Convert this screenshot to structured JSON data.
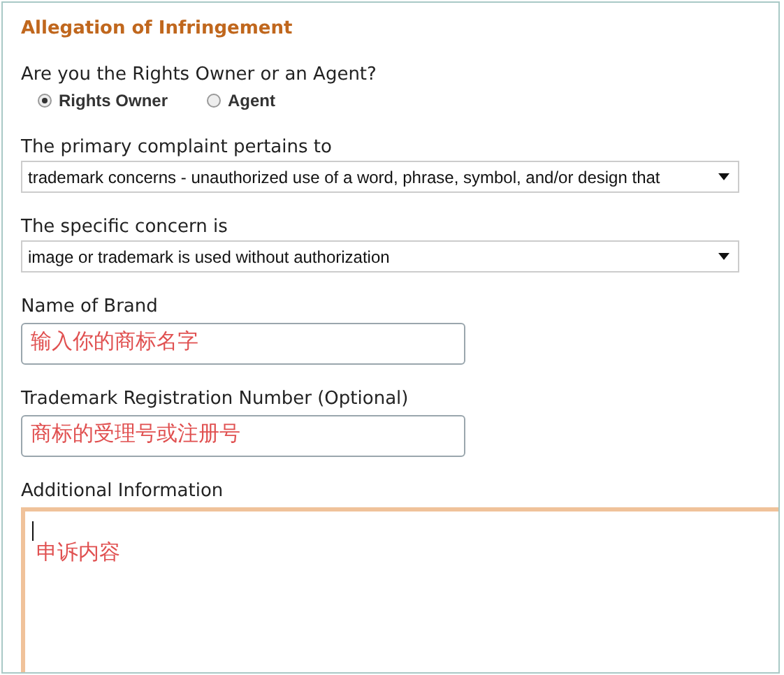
{
  "title": "Allegation of Infringement",
  "role": {
    "label": "Are you the Rights Owner or an Agent?",
    "options": [
      {
        "label": "Rights Owner",
        "selected": true
      },
      {
        "label": "Agent",
        "selected": false
      }
    ]
  },
  "fields": [
    {
      "kind": "select",
      "label": "The primary complaint pertains to",
      "value": "trademark concerns - unauthorized use of a word, phrase, symbol, and/or design that"
    },
    {
      "kind": "select",
      "label": "The specific concern is",
      "value": "image or trademark is used without authorization"
    },
    {
      "kind": "text",
      "label": "Name of Brand",
      "value": "输入你的商标名字"
    },
    {
      "kind": "text",
      "label": "Trademark Registration Number (Optional)",
      "value": "商标的受理号或注册号"
    },
    {
      "kind": "textarea",
      "label": "Additional Information",
      "value": "申诉内容",
      "focused": true
    }
  ]
}
